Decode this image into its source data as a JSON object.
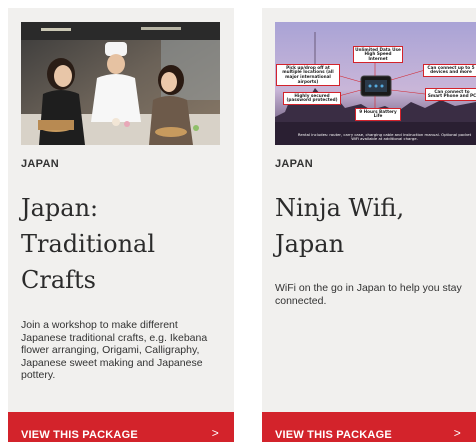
{
  "cards": [
    {
      "image_alt": "workshop-photo",
      "category": "JAPAN",
      "title": "Japan: Traditional Crafts",
      "description": "Join a workshop to make different Japanese traditional crafts, e.g. Ikebana flower arranging, Origami, Calligraphy, Japanese sweet making and Japanese pottery.",
      "cta_label": "VIEW THIS PACKAGE",
      "cta_icon": "chevron-right-icon"
    },
    {
      "image_alt": "wifi-router-infographic",
      "image_callouts": {
        "data": "Unlimited Data Use High Speed Internet",
        "pickup": "Pick up/drop off at multiple locations (all major international airports)",
        "connect": "Can connect up to 5 devices and more",
        "secured": "Highly secured (password protected)",
        "smartphone": "Can connect to Smart Phone and PC",
        "battery": "9 Hours Battery Life",
        "rental": "Rental includes: router, carry case, charging cable and instruction manual. Optional pocket WiFi available at additional charge."
      },
      "category": "JAPAN",
      "title": "Ninja Wifi, Japan",
      "description": "WiFi on the go in Japan to help you stay connected.",
      "cta_label": "VIEW THIS PACKAGE",
      "cta_icon": "chevron-right-icon"
    }
  ],
  "colors": {
    "card_bg": "#f1f0ee",
    "cta_bg": "#d3232b",
    "cta_text": "#ffffff",
    "title_text": "#2b2b2b"
  }
}
